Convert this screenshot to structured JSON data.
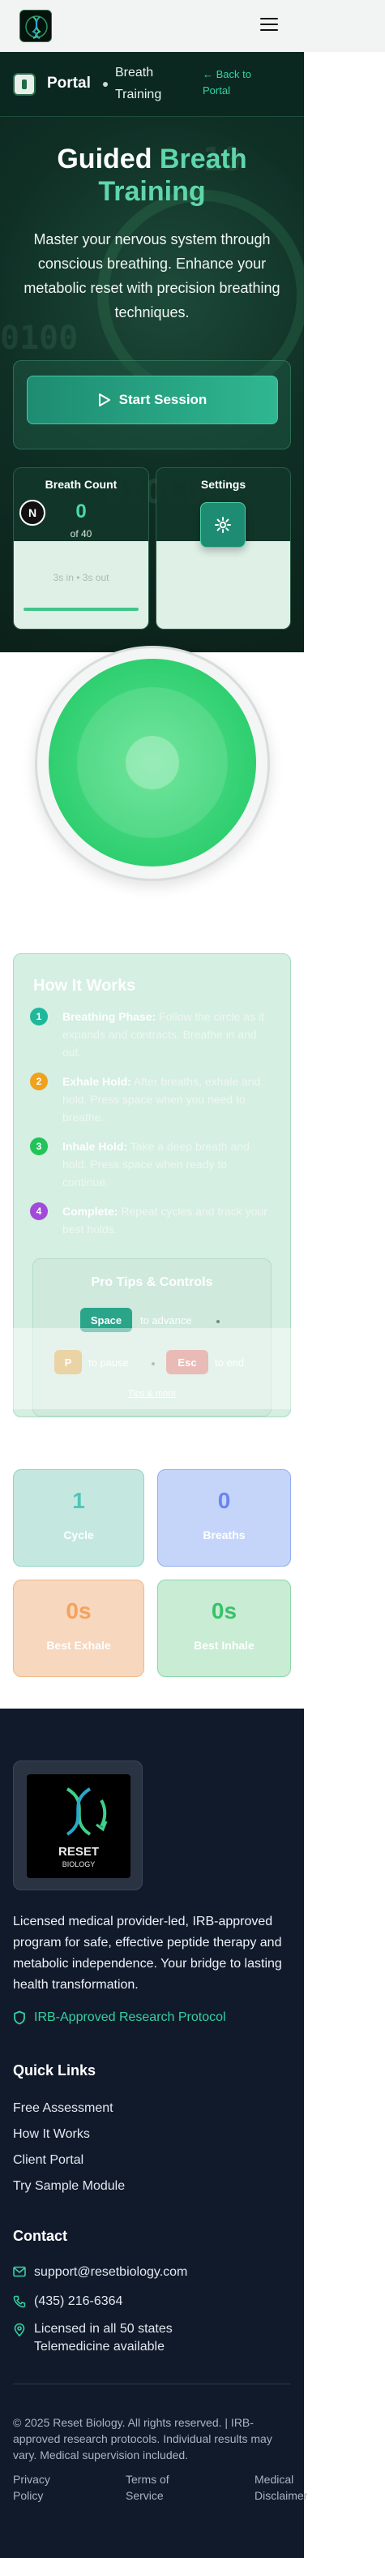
{
  "header": {
    "logo_alt": "Reset Biology logo",
    "menu_icon": "hamburger-menu-icon"
  },
  "portal_bar": {
    "portal_label": "Portal",
    "page_label": "Breath Training",
    "back_label": "← Back to Portal"
  },
  "hero": {
    "title_part1": "Guided",
    "title_part2": "Breath Training",
    "subtitle": "Master your nervous system through conscious breathing. Enhance your metabolic reset with precision breathing techniques.",
    "start_button": "Start Session"
  },
  "breath_count_card": {
    "title": "Breath Count",
    "count": "0",
    "of_total": "of 40",
    "ghost_text": "3s in • 3s out"
  },
  "settings_card": {
    "title": "Settings"
  },
  "avatar_letter": "N",
  "how_it_works": {
    "title": "How It Works",
    "steps": [
      {
        "num": "1",
        "title": "Breathing Phase:",
        "text": "Follow the circle as it expands and contracts. Breathe in and out."
      },
      {
        "num": "2",
        "title": "Exhale Hold:",
        "text": "After breaths, exhale and hold. Press space when you need to breathe."
      },
      {
        "num": "3",
        "title": "Inhale Hold:",
        "text": "Take a deep breath and hold. Press space when ready to continue."
      },
      {
        "num": "4",
        "title": "Complete:",
        "text": "Repeat cycles and track your best holds."
      }
    ],
    "tips": {
      "title": "Pro Tips & Controls",
      "space_key": "Space",
      "space_label": "to advance",
      "p_key": "P",
      "p_label": "to pause",
      "esc_key": "Esc",
      "esc_label": "to end",
      "details_link": "Tips & more"
    }
  },
  "stats": [
    {
      "value": "1",
      "label": "Cycle",
      "color": "#4fc6b8"
    },
    {
      "value": "0",
      "label": "Breaths",
      "color": "#6a84f0"
    },
    {
      "value": "0s",
      "label": "Best Exhale",
      "color": "#f4a25c"
    },
    {
      "value": "0s",
      "label": "Best Inhale",
      "color": "#37c26a"
    }
  ],
  "footer": {
    "description": "Licensed medical provider-led, IRB-approved program for safe, effective peptide therapy and metabolic independence. Your bridge to lasting health transformation.",
    "irb_badge": "IRB-Approved Research Protocol",
    "quick_links_title": "Quick Links",
    "quick_links": [
      "Free Assessment",
      "How It Works",
      "Client Portal",
      "Try Sample Module"
    ],
    "contact_title": "Contact",
    "email": "support@resetbiology.com",
    "phone": "(435) 216-6364",
    "licensed_line1": "Licensed in all 50 states",
    "licensed_line2": "Telemedicine available",
    "copyright": "© 2025 Reset Biology. All rights reserved. | IRB-approved research protocols. Individual results may vary. Medical supervision included.",
    "legal_links": [
      "Privacy Policy",
      "Terms of Service",
      "Medical Disclaimer"
    ],
    "logo_text": "RESET",
    "logo_subtext": "BIOLOGY"
  },
  "colors": {
    "accent": "#36d3a2",
    "hero_bg": "#0f2f25",
    "footer_bg": "#111a2b"
  }
}
